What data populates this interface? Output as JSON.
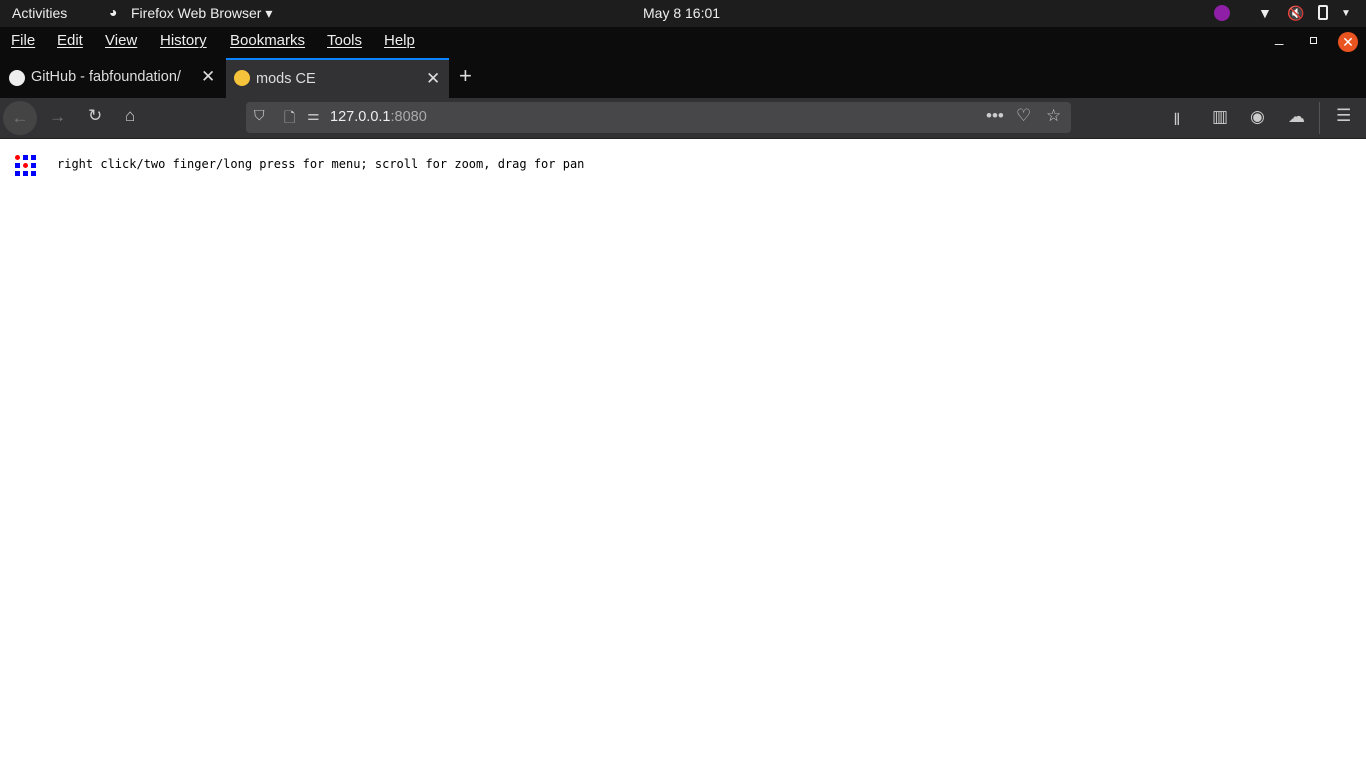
{
  "system_bar": {
    "activities": "Activities",
    "app_name": "Firefox Web Browser",
    "clock": "May 8  16:01"
  },
  "menu": [
    "File",
    "Edit",
    "View",
    "History",
    "Bookmarks",
    "Tools",
    "Help"
  ],
  "tabs": [
    {
      "title": "GitHub - fabfoundation/",
      "icon": "github-icon",
      "active": false
    },
    {
      "title": "mods CE",
      "icon": "sunglasses-emoji-icon",
      "active": true
    }
  ],
  "url": {
    "host": "127.0.0.1",
    "port": ":8080"
  },
  "page": {
    "hint": "right click/two finger/long press for menu; scroll for zoom, drag for pan"
  },
  "colors": {
    "accent": "#0a84ff",
    "close": "#e95420",
    "logo_blue": "#0000ff",
    "logo_red": "#ff0000"
  }
}
